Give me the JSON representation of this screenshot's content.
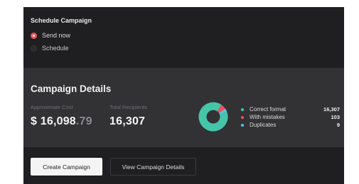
{
  "schedule": {
    "title": "Schedule Campaign",
    "options": [
      {
        "label": "Send now",
        "selected": true
      },
      {
        "label": "Schedule",
        "selected": false
      }
    ]
  },
  "details": {
    "title": "Campaign Details",
    "cost_label": "Approximate Cost",
    "cost_currency": "$",
    "cost_whole": "16,098",
    "cost_cents": ".79",
    "recipients_label": "Total Recipients",
    "recipients_value": "16,307",
    "breakdown": [
      {
        "label": "Correct format",
        "value": "16,307",
        "count": 16307,
        "color": "#45c6a8"
      },
      {
        "label": "With mistakes",
        "value": "103",
        "count": 103,
        "color": "#f0525c"
      },
      {
        "label": "Duplicates",
        "value": "9",
        "count": 9,
        "color": "#58c2ee"
      }
    ]
  },
  "actions": {
    "create_label": "Create Campaign",
    "view_label": "View Campaign Details"
  }
}
